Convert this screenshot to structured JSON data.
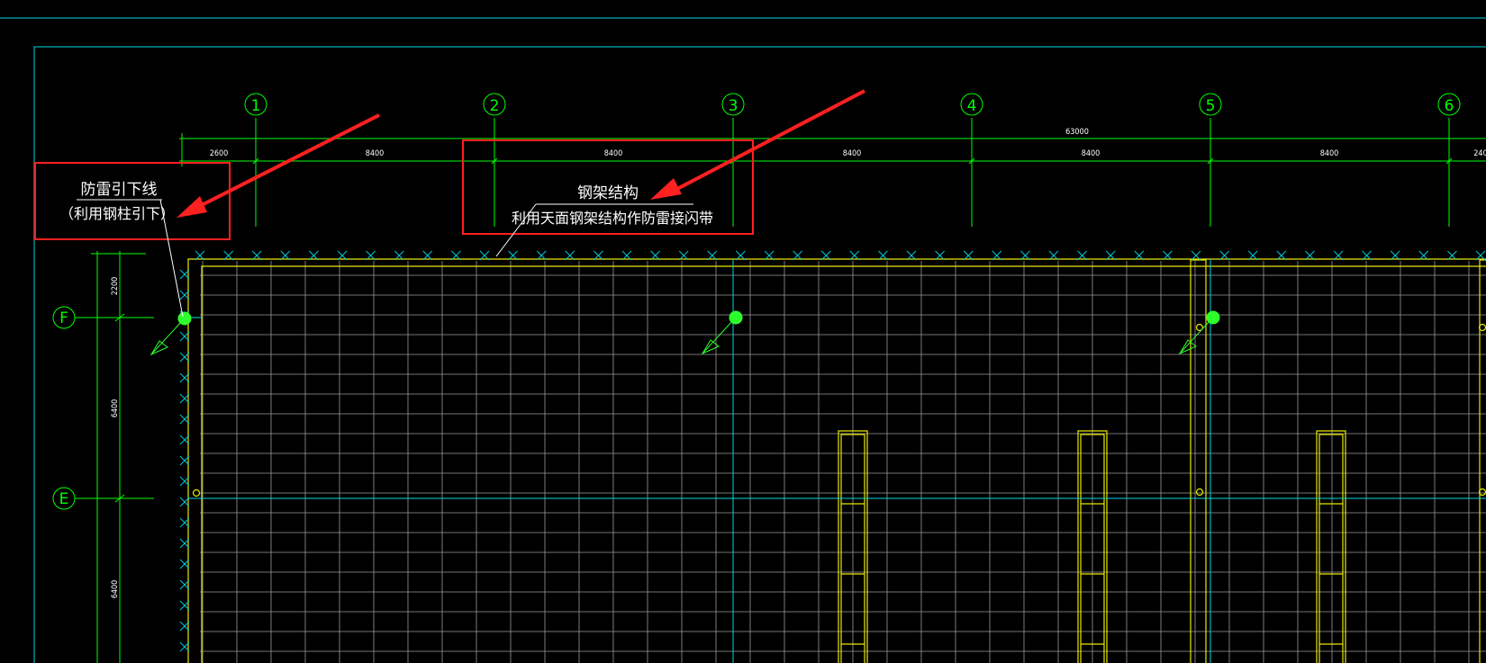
{
  "colors": {
    "background": "#000000",
    "axis_green": "#00ff00",
    "frame_cyan": "#00d8e0",
    "wall_yellow": "#e8e800",
    "grid_gray": "#9a9a9a",
    "annotation_red": "#ff2020",
    "text_white": "#ffffff",
    "rod_marker_green": "#2cff2c"
  },
  "axes_top": [
    "1",
    "2",
    "3",
    "4",
    "5",
    "6"
  ],
  "axes_left": [
    "F",
    "E"
  ],
  "dimensions_top": {
    "total": "63000",
    "segments": [
      "2600",
      "8400",
      "8400",
      "8400",
      "8400",
      "8400",
      "240"
    ]
  },
  "dimensions_left": [
    "2200",
    "6400",
    "6400"
  ],
  "annotations": {
    "downlead": {
      "line1": "防雷引下线",
      "line2": "（利用钢柱引下）"
    },
    "steel_frame": {
      "line1": "钢架结构",
      "line2": "利用天面钢架结构作防雷接闪带"
    }
  }
}
